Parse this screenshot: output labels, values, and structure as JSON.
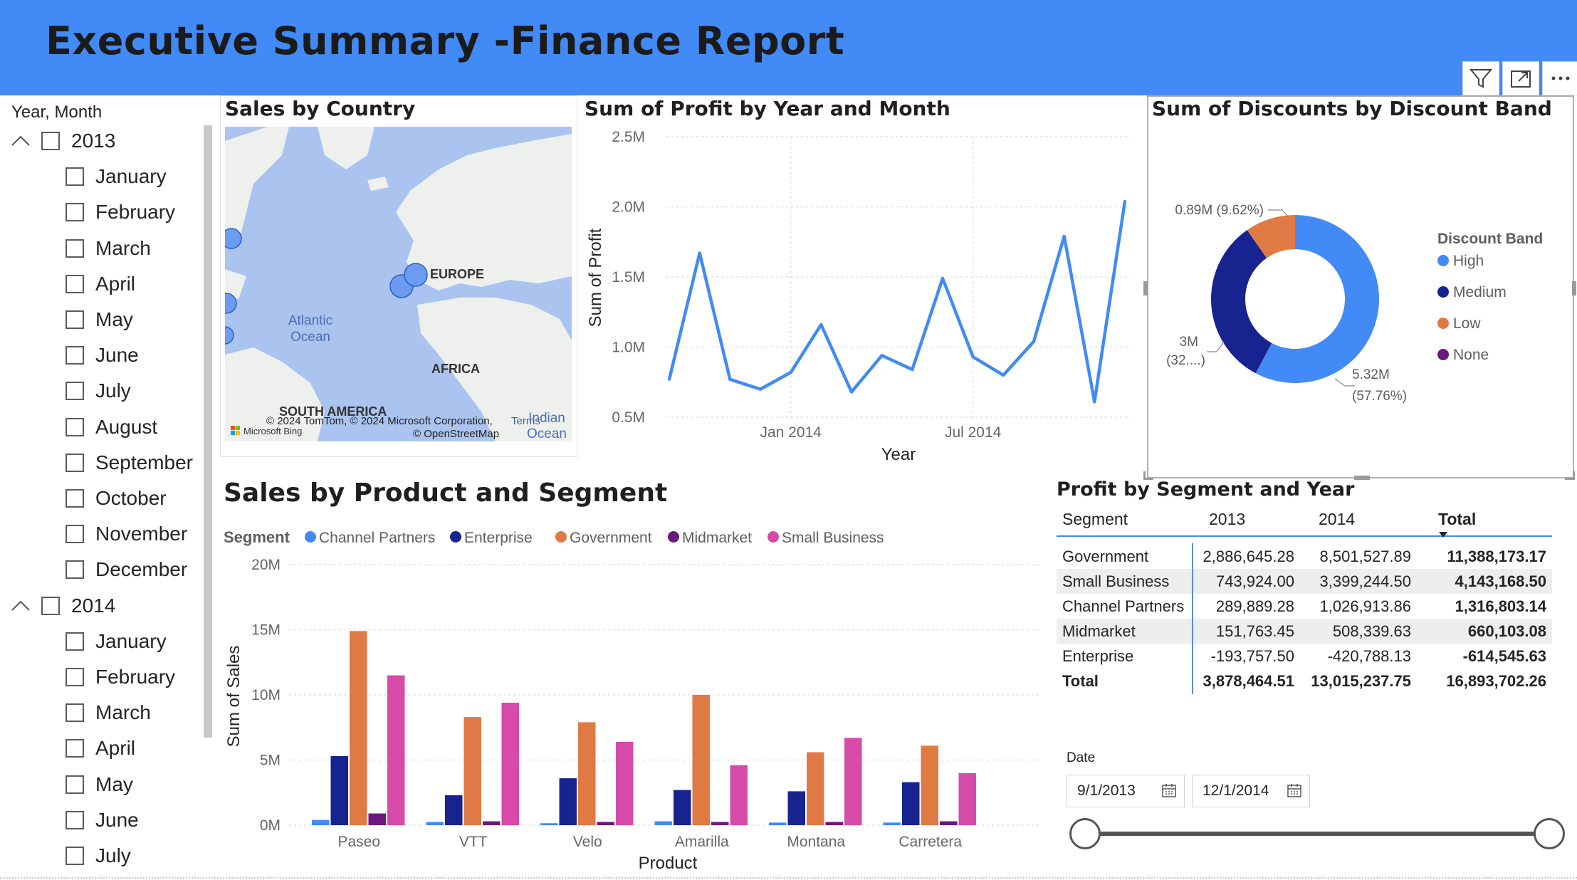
{
  "header": {
    "title": "Executive Summary -Finance Report",
    "bg_color": "#428af5",
    "toolbar_icons": [
      "filter-icon",
      "focus-mode-icon",
      "more-options-icon"
    ]
  },
  "slicer": {
    "title": "Year, Month",
    "years": [
      {
        "label": "2013",
        "months": [
          "January",
          "February",
          "March",
          "April",
          "May",
          "June",
          "July",
          "August",
          "September",
          "October",
          "November",
          "December"
        ]
      },
      {
        "label": "2014",
        "months": [
          "January",
          "February",
          "March",
          "April",
          "May",
          "June",
          "July"
        ]
      }
    ]
  },
  "map": {
    "title": "Sales by Country",
    "labels": {
      "europe": "EUROPE",
      "atlantic": "Atlantic Ocean",
      "africa": "AFRICA",
      "south_america": "SOUTH AMERICA",
      "indian": "Indian Ocean"
    },
    "copyright": "© 2024 TomTom, © 2024 Microsoft Corporation,",
    "osm": "© OpenStreetMap",
    "terms": "Terms",
    "brand": "Microsoft Bing"
  },
  "profit_line": {
    "title": "Sum of Profit by Year and Month",
    "xlabel": "Year",
    "ylabel": "Sum of Profit",
    "yticks": [
      "2.5M",
      "2.0M",
      "1.5M",
      "1.0M",
      "0.5M"
    ],
    "xticks": [
      "Jan 2014",
      "Jul 2014"
    ],
    "color": "#428af5"
  },
  "discounts": {
    "title": "Sum of Discounts by Discount Band",
    "legend_title": "Discount Band",
    "legend": [
      {
        "label": "High",
        "color": "#428af5"
      },
      {
        "label": "Medium",
        "color": "#17238e"
      },
      {
        "label": "Low",
        "color": "#e07a44"
      },
      {
        "label": "None",
        "color": "#6a1a7c"
      }
    ],
    "labels": {
      "low": "0.89M (9.62%)",
      "medium_value": "3M",
      "medium_pct": "(32....)",
      "high_value": "5.32M",
      "high_pct": "(57.76%)"
    }
  },
  "product_segment": {
    "title": "Sales by Product and Segment",
    "legend_title": "Segment",
    "xlabel": "Product",
    "ylabel": "Sum of Sales",
    "yticks": [
      "20M",
      "15M",
      "10M",
      "5M",
      "0M"
    ]
  },
  "matrix": {
    "title": "Profit by Segment and Year",
    "headers": [
      "Segment",
      "2013",
      "2014",
      "Total"
    ],
    "rows": [
      [
        "Government",
        "2,886,645.28",
        "8,501,527.89",
        "11,388,173.17"
      ],
      [
        "Small Business",
        "743,924.00",
        "3,399,244.50",
        "4,143,168.50"
      ],
      [
        "Channel Partners",
        "289,889.28",
        "1,026,913.86",
        "1,316,803.14"
      ],
      [
        "Midmarket",
        "151,763.45",
        "508,339.63",
        "660,103.08"
      ],
      [
        "Enterprise",
        "-193,757.50",
        "-420,788.13",
        "-614,545.63"
      ]
    ],
    "total": [
      "Total",
      "3,878,464.51",
      "13,015,237.75",
      "16,893,702.26"
    ]
  },
  "date_slicer": {
    "title": "Date",
    "start": "9/1/2013",
    "end": "12/1/2014"
  },
  "chart_data": [
    {
      "type": "line",
      "title": "Sum of Profit by Year and Month",
      "xlabel": "Year",
      "ylabel": "Sum of Profit",
      "x": [
        "2013-09",
        "2013-10",
        "2013-11",
        "2013-12",
        "2014-01",
        "2014-02",
        "2014-03",
        "2014-04",
        "2014-05",
        "2014-06",
        "2014-07",
        "2014-08",
        "2014-09",
        "2014-10",
        "2014-11",
        "2014-12"
      ],
      "values": [
        0.77,
        1.67,
        0.77,
        0.7,
        0.82,
        1.16,
        0.68,
        0.94,
        0.84,
        1.49,
        0.93,
        0.8,
        1.04,
        1.79,
        0.61,
        2.04
      ],
      "unit": "M",
      "ylim": [
        0.5,
        2.5
      ],
      "grid": true
    },
    {
      "type": "pie",
      "title": "Sum of Discounts by Discount Band",
      "categories": [
        "High",
        "Medium",
        "Low",
        "None"
      ],
      "values": [
        5.32,
        3.0,
        0.89,
        0.0
      ],
      "percents": [
        57.76,
        32.62,
        9.62,
        0.0
      ],
      "legend": "right"
    },
    {
      "type": "bar",
      "title": "Sales by Product and Segment",
      "xlabel": "Product",
      "ylabel": "Sum of Sales",
      "categories": [
        "Paseo",
        "VTT",
        "Velo",
        "Amarilla",
        "Montana",
        "Carretera"
      ],
      "ylim": [
        0,
        20
      ],
      "unit": "M",
      "legend": "top-left",
      "series": [
        {
          "name": "Channel Partners",
          "color": "#428af5",
          "values": [
            0.4,
            0.25,
            0.15,
            0.3,
            0.2,
            0.2
          ]
        },
        {
          "name": "Enterprise",
          "color": "#17238e",
          "values": [
            5.3,
            2.3,
            3.6,
            2.7,
            2.6,
            3.3
          ]
        },
        {
          "name": "Government",
          "color": "#e07a44",
          "values": [
            14.9,
            8.3,
            7.9,
            10.0,
            5.6,
            6.1
          ]
        },
        {
          "name": "Midmarket",
          "color": "#6a1a7c",
          "values": [
            0.9,
            0.3,
            0.25,
            0.25,
            0.25,
            0.3
          ]
        },
        {
          "name": "Small Business",
          "color": "#d64aa8",
          "values": [
            11.5,
            9.4,
            6.4,
            4.6,
            6.7,
            4.0
          ]
        }
      ]
    }
  ]
}
